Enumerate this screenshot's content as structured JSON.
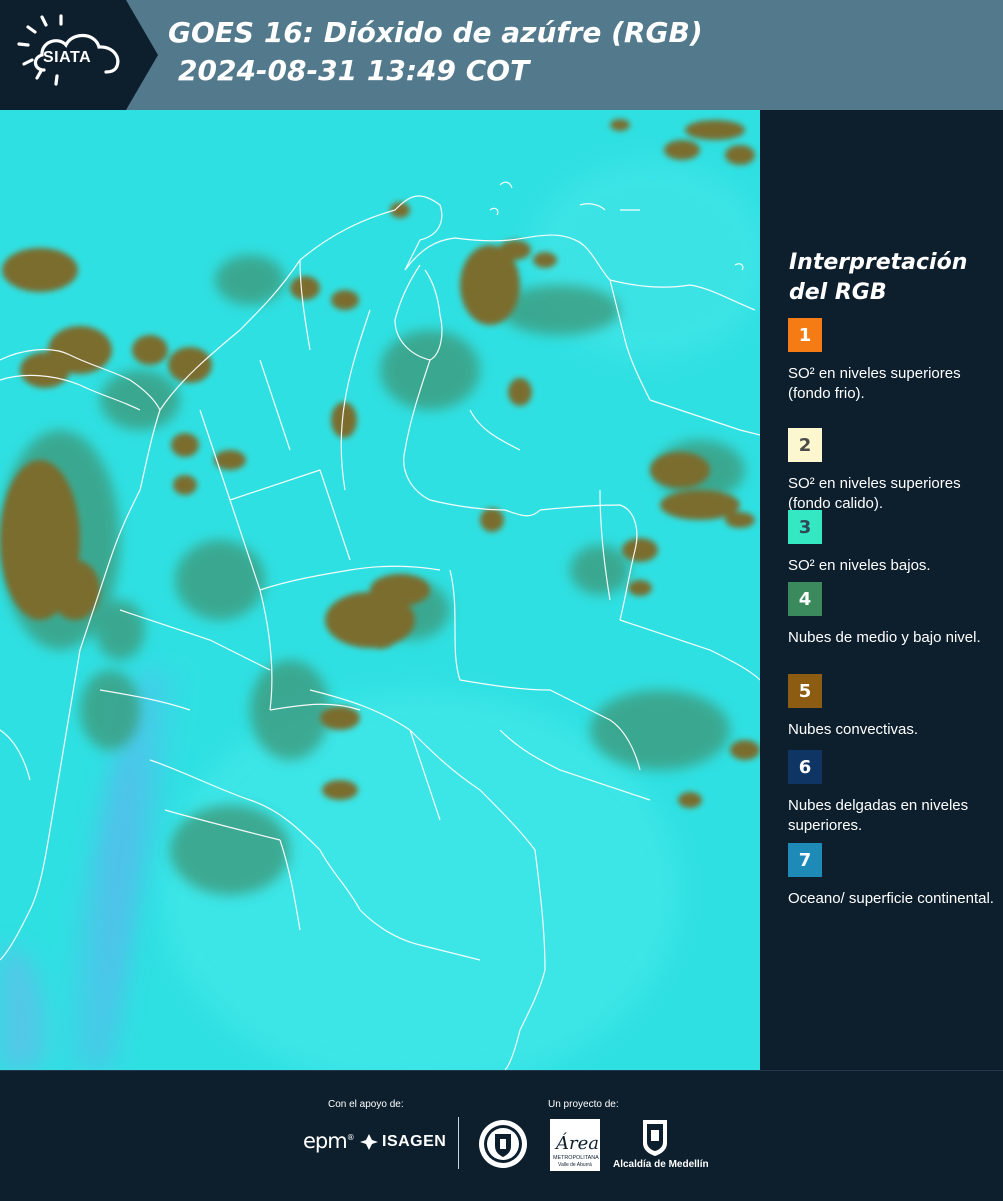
{
  "header": {
    "title_line1": "GOES 16: Dióxido de azúfre (RGB)",
    "title_line2": "2024-08-31 13:49 COT",
    "logo_text": "SIATA",
    "logo_icon": "sun-cloud-icon",
    "background_color": "#527a8c",
    "logo_block_color": "#0d1f2d"
  },
  "map": {
    "base_color": "#2fe0e2",
    "colors": {
      "convective_cloud": "#7a6d2e",
      "mid_low_cloud": "#3e9b7e",
      "ocean_surface": "#58b8ea",
      "border_line": "#ffffff"
    }
  },
  "legend": {
    "title_line1": "Interpretación",
    "title_line2": "del RGB",
    "items": [
      {
        "number": "1",
        "color": "#f57c14",
        "text_color": "#ffffff",
        "label": "SO² en niveles superiores (fondo frio)."
      },
      {
        "number": "2",
        "color": "#fdf7cf",
        "text_color": "#4a4a4a",
        "label": "SO² en niveles superiores (fondo calido)."
      },
      {
        "number": "3",
        "color": "#35e8c4",
        "text_color": "#2d4a55",
        "label": "SO² en niveles bajos."
      },
      {
        "number": "4",
        "color": "#3a8a5e",
        "text_color": "#ffffff",
        "label": "Nubes de medio y bajo nivel."
      },
      {
        "number": "5",
        "color": "#8c5c12",
        "text_color": "#ffffff",
        "label": "Nubes convectivas."
      },
      {
        "number": "6",
        "color": "#0f3565",
        "text_color": "#ffffff",
        "label": "Nubes delgadas en niveles superiores."
      },
      {
        "number": "7",
        "color": "#1d8ab8",
        "text_color": "#ffffff",
        "label": "Oceano/ superficie continental."
      }
    ]
  },
  "footer": {
    "support_caption": "Con el apoyo de:",
    "project_caption": "Un proyecto de:",
    "sponsors": {
      "epm": "epm",
      "isagen": "ISAGEN"
    },
    "project_logos": {
      "metropolitana_main": "Área",
      "metropolitana_sub": "METROPOLITANA",
      "metropolitana_sub2": "Valle de Aburrá",
      "alcaldia": "Alcaldía de Medellín",
      "seal_icon": "medellin-seal-icon",
      "shield_icon": "medellin-shield-icon"
    }
  }
}
